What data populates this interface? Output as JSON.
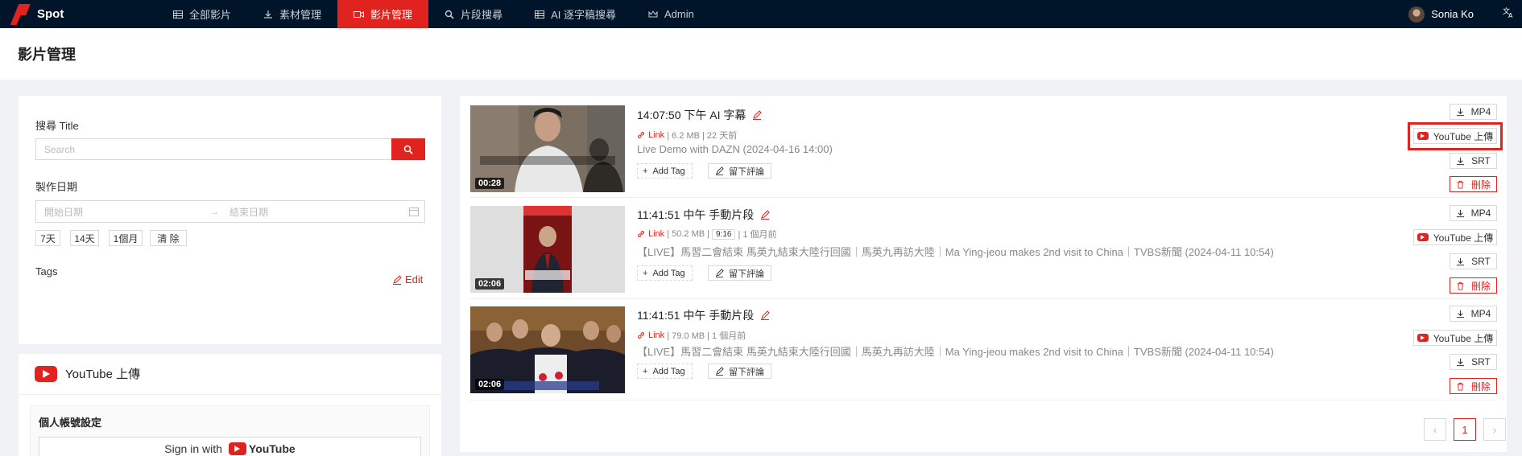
{
  "app": {
    "name": "Spot"
  },
  "nav": {
    "items": [
      {
        "label": "全部影片",
        "icon": "table-icon"
      },
      {
        "label": "素材管理",
        "icon": "download-icon"
      },
      {
        "label": "影片管理",
        "icon": "video-icon"
      },
      {
        "label": "片段搜尋",
        "icon": "search-icon"
      },
      {
        "label": "AI 逐字稿搜尋",
        "icon": "table-icon"
      },
      {
        "label": "Admin",
        "icon": "crown-icon"
      }
    ],
    "active": "影片管理",
    "user": "Sonia Ko",
    "lang_icon": "translate-icon"
  },
  "page": {
    "title": "影片管理"
  },
  "filter": {
    "search_label": "搜尋 Title",
    "search_placeholder": "Search",
    "date_label": "製作日期",
    "date_start_placeholder": "開始日期",
    "date_end_placeholder": "結束日期",
    "quick_ranges": [
      "7天",
      "14天",
      "1個月",
      "清 除"
    ],
    "tags_label": "Tags",
    "edit_label": "Edit"
  },
  "youtube": {
    "title": "YouTube 上傳",
    "account_title": "個人帳號設定",
    "signin_text": "Sign in with",
    "signin_brand": "YouTube"
  },
  "videos": [
    {
      "title": "14:07:50 下午 AI 字幕",
      "link": "Link",
      "meta": "| 6.2 MB | 22 天前",
      "ratio": "",
      "desc": "Live Demo with DAZN (2024-04-16 14:00)",
      "duration": "00:28"
    },
    {
      "title": "11:41:51 中午 手動片段",
      "link": "Link",
      "meta_pre": "| 50.2 MB |",
      "ratio": "9:16",
      "meta": "| 1 個月前",
      "desc": "【LIVE】馬習二會結束 馬英九結束大陸行回國｜馬英九再訪大陸｜Ma Ying-jeou makes 2nd visit to China｜TVBS新聞 (2024-04-11 10:54)",
      "duration": "02:06"
    },
    {
      "title": "11:41:51 中午 手動片段",
      "link": "Link",
      "meta": "| 79.0 MB | 1 個月前",
      "ratio": "",
      "desc": "【LIVE】馬習二會結束 馬英九結束大陸行回國｜馬英九再訪大陸｜Ma Ying-jeou makes 2nd visit to China｜TVBS新聞 (2024-04-11 10:54)",
      "duration": "02:06"
    }
  ],
  "actions": {
    "add_tag": "Add Tag",
    "comment": "留下評論",
    "mp4": "MP4",
    "youtube_upload": "YouTube 上傳",
    "srt": "SRT",
    "delete": "刪除"
  },
  "pagination": {
    "prev": "‹",
    "current": "1",
    "next": "›"
  },
  "colors": {
    "accent": "#e0231e",
    "nav_bg": "#001529"
  }
}
